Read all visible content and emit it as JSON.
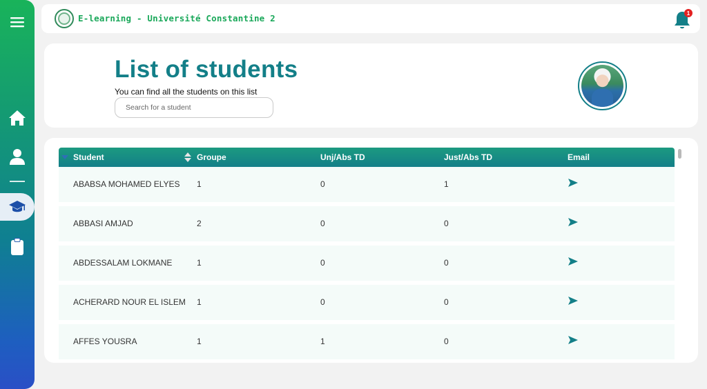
{
  "app": {
    "brand": "E-learning - Université Constantine 2",
    "notification_count": "1"
  },
  "sidebar": {
    "items": [
      {
        "icon": "menu-icon"
      },
      {
        "icon": "home-icon"
      },
      {
        "icon": "user-icon"
      },
      {
        "icon": "graduation-cap-icon",
        "active": true
      },
      {
        "icon": "clipboard-icon"
      }
    ]
  },
  "header": {
    "title": "List of students",
    "subtitle": "You can find all the students on this list",
    "search_placeholder": "Search for a student"
  },
  "table": {
    "columns": [
      "Student",
      "Groupe",
      "Unj/Abs TD",
      "Just/Abs TD",
      "Email"
    ],
    "rows": [
      {
        "student": "ABABSA MOHAMED ELYES",
        "groupe": "1",
        "unj": "0",
        "just": "1"
      },
      {
        "student": "ABBASI AMJAD",
        "groupe": "2",
        "unj": "0",
        "just": "0"
      },
      {
        "student": "ABDESSALAM LOKMANE",
        "groupe": "1",
        "unj": "0",
        "just": "0"
      },
      {
        "student": "ACHERARD NOUR EL ISLEM",
        "groupe": "1",
        "unj": "0",
        "just": "0"
      },
      {
        "student": "AFFES YOUSRA",
        "groupe": "1",
        "unj": "1",
        "just": "0"
      }
    ]
  },
  "colors": {
    "accent": "#137f88",
    "brand_green": "#1aa85a",
    "row_bg": "#f4fbf9",
    "badge_red": "#e32121"
  }
}
